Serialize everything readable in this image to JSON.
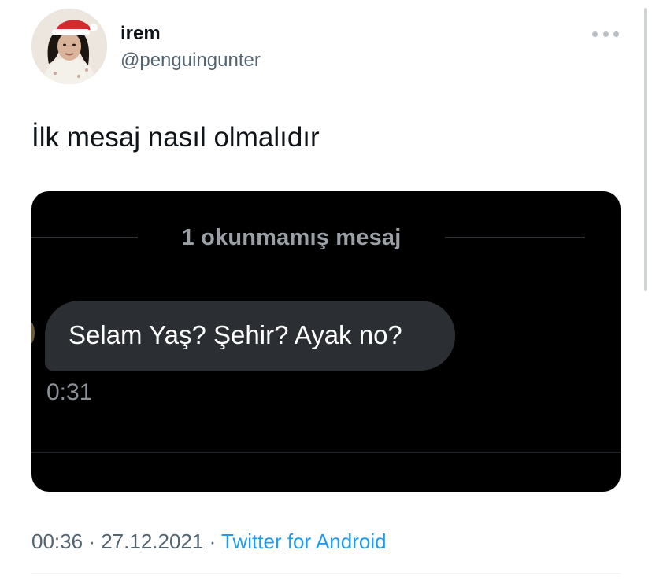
{
  "author": {
    "display_name": "irem",
    "handle": "@penguingunter",
    "avatar_icon": "profile-photo"
  },
  "tweet": {
    "text": "İlk mesaj nasıl olmalıdır"
  },
  "media": {
    "unread_label": "1 okunmamış mesaj",
    "message_text": "Selam Yaş? Şehir? Ayak no?",
    "message_time": "0:31"
  },
  "meta": {
    "time": "00:36",
    "separator": "·",
    "date": "27.12.2021",
    "source": "Twitter for Android"
  },
  "colors": {
    "link": "#1d9bf0",
    "secondary_text": "#536471",
    "card_background": "#000000",
    "bubble_background": "#2b2f33"
  }
}
